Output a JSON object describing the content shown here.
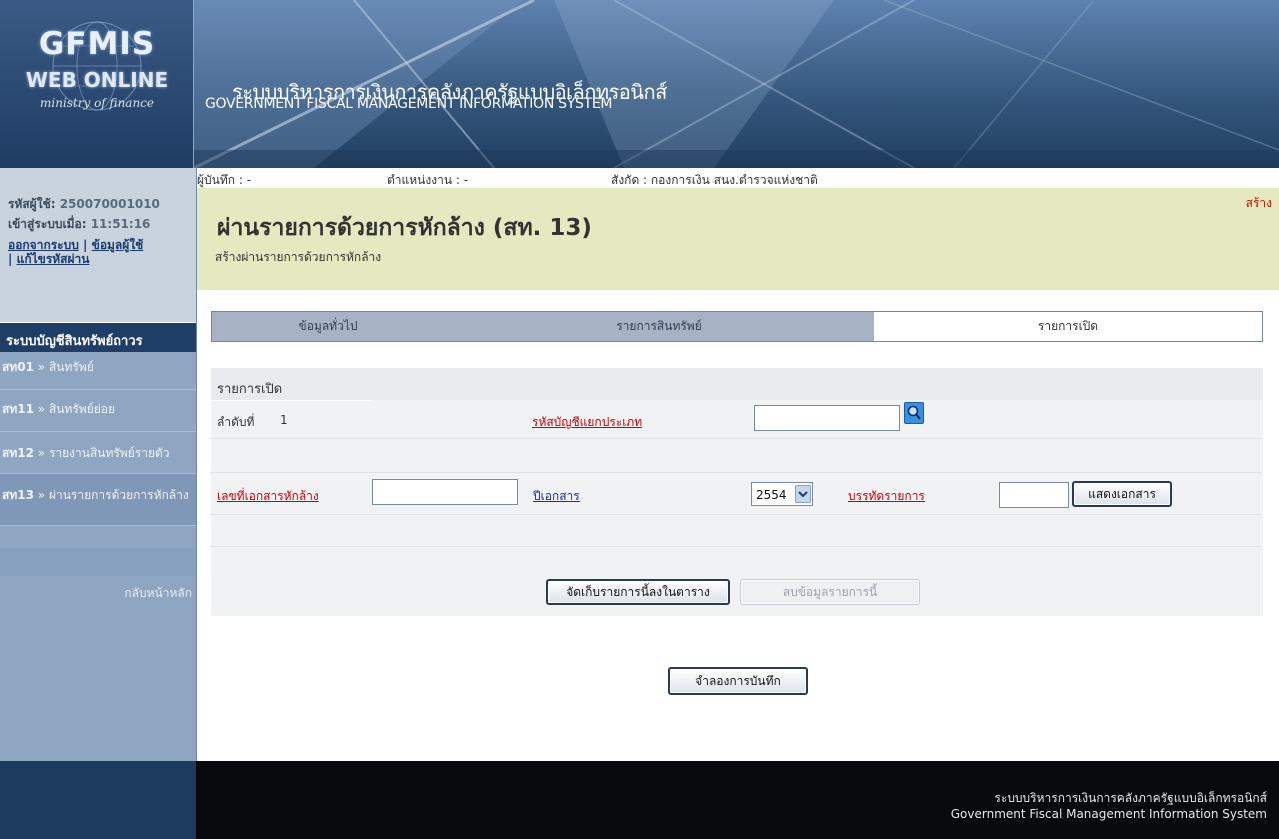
{
  "banner": {
    "logo_line1": "GFMIS",
    "logo_line2": "WEB ONLINE",
    "logo_line3": "ministry of finance",
    "title_th": "ระบบบริหารการเงินการคลังภาครัฐแบบอิเล็กทรอนิกส์",
    "title_en": "GOVERNMENT FISCAL MANAGEMENT INFORMATION SYSTEM"
  },
  "user": {
    "id_label": "รหัสผู้ใช้:",
    "id_value": "250070001010",
    "login_label": "เข้าสู่ระบบเมื่อ:",
    "login_value": "11:51:16",
    "logout_link": "ออกจากระบบ",
    "userinfo_link": "ข้อมูลผู้ใช้",
    "changepw_link": "แก้ไขรหัสผ่าน",
    "separator": "|"
  },
  "sidebar": {
    "title": "ระบบบัญชีสินทรัพย์ถาวร",
    "items": [
      {
        "code": "สท01",
        "label": "สินทรัพย์"
      },
      {
        "code": "สท11",
        "label": "สินทรัพย์ย่อย"
      },
      {
        "code": "สท12",
        "label": "รายงานสินทรัพย์รายตัว"
      },
      {
        "code": "สท13",
        "label": "ผ่านรายการด้วยการหักล้าง"
      }
    ],
    "arrow": "»",
    "back_home": "กลับหน้าหลัก"
  },
  "infobar": {
    "recorder": "ผู้บันทึก : -",
    "position": "ตำแหน่งงาน : -",
    "affiliation": "สังกัด : กองการเงิน สนง.ตำรวจแห่งชาติ",
    "mode": "สร้าง"
  },
  "page": {
    "title": "ผ่านรายการด้วยการหักล้าง (สท. 13)",
    "subtitle": "สร้างผ่านรายการด้วยการหักล้าง"
  },
  "tabs": [
    {
      "label": "ข้อมูลทั่วไป",
      "active": false
    },
    {
      "label": "รายการสินทรัพย์",
      "active": false
    },
    {
      "label": "รายการเปิด",
      "active": true
    }
  ],
  "form": {
    "section_title": "รายการเปิด",
    "seq_label": "ลำดับที่",
    "seq_value": "1",
    "gl_code_link": "รหัสบัญชีแยกประเภท",
    "gl_code_value": "",
    "clearing_doc_link": "เลขที่เอกสารหักล้าง",
    "clearing_doc_value": "",
    "doc_year_link": "ปีเอกสาร",
    "doc_year_value": "2554",
    "line_item_link": "บรรทัดรายการ",
    "line_item_value": "",
    "show_doc_button": "แสดงเอกสาร",
    "save_row_button": "จัดเก็บรายการนี้ลงในตาราง",
    "delete_row_button": "ลบข้อมูลรายการนี้"
  },
  "simulate_button": "จำลองการบันทึก",
  "footer": {
    "th": "ระบบบริหารการเงินการคลังภาครัฐแบบอิเล็กทรอนิกส์",
    "en": "Government Fiscal Management Information System"
  },
  "colors": {
    "banner_dark": "#1f3f66",
    "sidebar": "#8ea6c2",
    "menu_title": "#1e3e68",
    "heading_bg": "#e4e9bf",
    "required_link": "#cc0000",
    "optional_link": "#1a2ea0",
    "footer": "#07090c"
  }
}
